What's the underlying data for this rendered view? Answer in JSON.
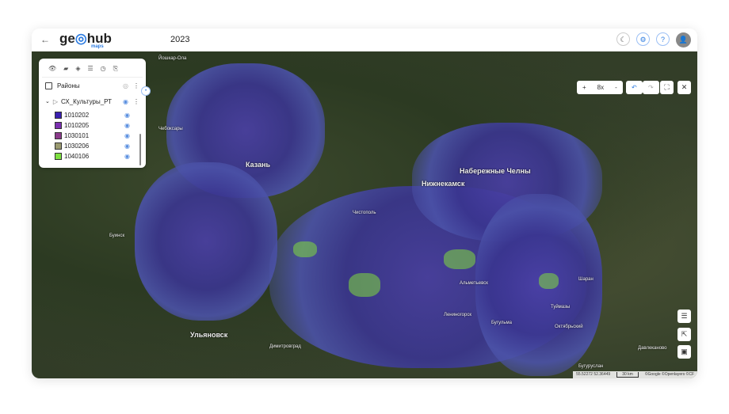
{
  "header": {
    "back_icon": "arrow-left-icon",
    "logo": "geohub",
    "logo_sub": "maps",
    "year": "2023",
    "buttons": [
      "theme-icon",
      "settings-icon",
      "help-icon",
      "user-avatar-icon"
    ]
  },
  "panel": {
    "tools": [
      "layers-visibility-icon",
      "folder-icon",
      "add-layer-icon",
      "legend-list-icon",
      "history-icon",
      "export-icon"
    ],
    "layers": [
      {
        "name": "Районы",
        "visible": false
      },
      {
        "name": "СХ_Культуры_РТ",
        "visible": true
      }
    ],
    "legend": [
      {
        "code": "1010202",
        "color": "#3a1fb0"
      },
      {
        "code": "1010205",
        "color": "#7a2fb0"
      },
      {
        "code": "1030101",
        "color": "#8a3a8a"
      },
      {
        "code": "1030206",
        "color": "#9a9a70"
      },
      {
        "code": "1040106",
        "color": "#7ee040"
      }
    ]
  },
  "toolbar": {
    "zoom_in": "+",
    "zoom": "8x",
    "zoom_out": "-",
    "undo": "↶",
    "redo": "↷"
  },
  "map": {
    "labels": [
      "Йошкар-Ола",
      "Казань",
      "Нижнекамск",
      "Набережные Челны",
      "Ульяновск",
      "Чистополь",
      "Альметьевск",
      "Бугульма",
      "Димитровград",
      "Лениногорск",
      "Шаран",
      "Туймазы",
      "Буинск",
      "Октябрьский",
      "Давлеканово",
      "Бугуруслан",
      "Чебоксары"
    ]
  },
  "footer": {
    "coords": "55.52272 52.36449",
    "scale": "30 km",
    "attribution": "©Google ©Openlayers ©CF"
  }
}
